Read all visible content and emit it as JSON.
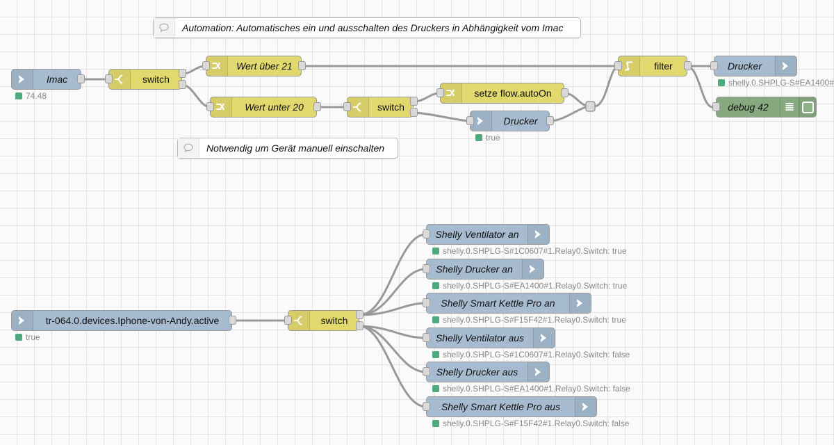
{
  "editor": {
    "name": "node-red-flow-canvas",
    "background": "#fafafa",
    "grid_color": "#e3e3e3",
    "colors": {
      "node_blue": "#a6bbcf",
      "node_yellow": "#e2d96e",
      "node_green": "#87a980",
      "wire": "#999999",
      "status_dot_green": "#4ea97d",
      "status_text": "#888888"
    }
  },
  "comments": [
    {
      "id": "comment-automation",
      "text": "Automation: Automatisches ein und ausschalten des Druckers in Abhängigkeit vom Imac",
      "icon": "comment-icon"
    },
    {
      "id": "comment-manuell",
      "text": "Notwendig um Gerät manuell einschalten",
      "icon": "comment-icon"
    }
  ],
  "flow_top": {
    "nodes": [
      {
        "id": "node-imac",
        "label": "Imac",
        "type": "input",
        "color": "blue",
        "icon": "arrow-right-icon",
        "status": "74.48"
      },
      {
        "id": "node-switch-1",
        "label": "switch",
        "type": "switch",
        "color": "yellow",
        "icon": "switch-icon",
        "status": ""
      },
      {
        "id": "node-wert-ueber",
        "label": "Wert über 21",
        "type": "change",
        "color": "yellow",
        "icon": "change-icon",
        "status": ""
      },
      {
        "id": "node-wert-unter",
        "label": "Wert unter 20",
        "type": "change",
        "color": "yellow",
        "icon": "change-icon",
        "status": ""
      },
      {
        "id": "node-switch-2",
        "label": "switch",
        "type": "switch",
        "color": "yellow",
        "icon": "switch-icon",
        "status": ""
      },
      {
        "id": "node-setze-flow",
        "label": "setze flow.autoOn",
        "type": "change",
        "color": "yellow",
        "icon": "change-icon",
        "status": ""
      },
      {
        "id": "node-drucker-mid",
        "label": "Drucker",
        "type": "input",
        "color": "blue",
        "icon": "arrow-right-icon",
        "status": "true"
      },
      {
        "id": "node-filter",
        "label": "filter",
        "type": "rbe",
        "color": "yellow",
        "icon": "filter-icon",
        "status": ""
      },
      {
        "id": "node-drucker-out",
        "label": "Drucker",
        "type": "output",
        "color": "blue",
        "icon": "arrow-right-icon",
        "status": "shelly.0.SHPLG-S#EA1400#"
      },
      {
        "id": "node-debug-42",
        "label": "debug 42",
        "type": "debug",
        "color": "green",
        "icon": "debug-lines-icon",
        "status": ""
      }
    ]
  },
  "flow_bottom": {
    "source": {
      "id": "node-iphone",
      "label": "tr-064.0.devices.Iphone-von-Andy.active",
      "color": "blue",
      "icon": "arrow-right-icon",
      "status": "true"
    },
    "switch": {
      "id": "node-switch-3",
      "label": "switch",
      "color": "yellow",
      "icon": "switch-icon"
    },
    "targets": [
      {
        "id": "node-shelly-ventilator-an",
        "label": "Shelly Ventilator an",
        "status": "shelly.0.SHPLG-S#1C0607#1.Relay0.Switch: true"
      },
      {
        "id": "node-shelly-drucker-an",
        "label": "Shelly Drucker an",
        "status": "shelly.0.SHPLG-S#EA1400#1.Relay0.Switch: true"
      },
      {
        "id": "node-shelly-smart-kettle-pro-an",
        "label": "Shelly Smart Kettle Pro an",
        "status": "shelly.0.SHPLG-S#F15F42#1.Relay0.Switch: true"
      },
      {
        "id": "node-shelly-ventilator-aus",
        "label": "Shelly Ventilator aus",
        "status": "shelly.0.SHPLG-S#1C0607#1.Relay0.Switch: false"
      },
      {
        "id": "node-shelly-drucker-aus",
        "label": "Shelly Drucker aus",
        "status": "shelly.0.SHPLG-S#EA1400#1.Relay0.Switch: false"
      },
      {
        "id": "node-shelly-smart-kettle-pro-aus",
        "label": "Shelly Smart Kettle Pro aus",
        "status": "shelly.0.SHPLG-S#F15F42#1.Relay0.Switch: false"
      }
    ]
  }
}
